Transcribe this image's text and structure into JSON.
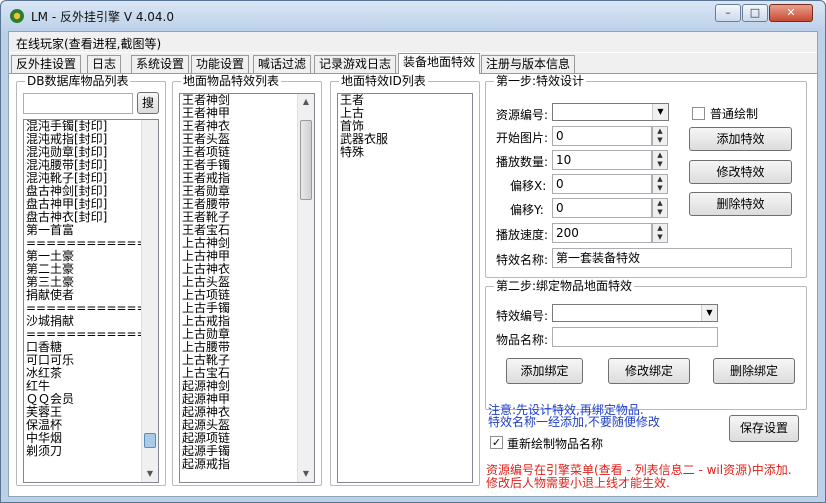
{
  "window": {
    "title": "LM - 反外挂引擎 V 4.04.0",
    "minimize": "–",
    "maximize": "□",
    "close": "✕"
  },
  "menu": {
    "online_players": "在线玩家(查看进程,截图等)"
  },
  "tabs": [
    "反外挂设置",
    "日志",
    "系统设置",
    "功能设置",
    "喊话过滤",
    "记录游戏日志",
    "装备地面特效",
    "注册与版本信息"
  ],
  "db_panel": {
    "legend": "DB数据库物品列表",
    "search_value": "",
    "search_button": "搜",
    "items": [
      "混沌手镯[封印]",
      "混沌戒指[封印]",
      "混沌勋章[封印]",
      "混沌腰带[封印]",
      "混沌靴子[封印]",
      "盘古神剑[封印]",
      "盘古神甲[封印]",
      "盘古神衣[封印]",
      "第一首富",
      "=================",
      "第一土豪",
      "第二土豪",
      "第三土豪",
      "捐献使者",
      "=================",
      "沙城捐献",
      "=================",
      "口香糖",
      "可口可乐",
      "冰红茶",
      "红牛",
      "ＱＱ会员",
      "芙蓉王",
      "保温杯",
      "中华烟",
      "剃须刀"
    ]
  },
  "ground_effect_panel": {
    "legend": "地面物品特效列表",
    "items": [
      "王者神剑",
      "王者神甲",
      "王者神衣",
      "王者头盔",
      "王者项链",
      "王者手镯",
      "王者戒指",
      "王者勋章",
      "王者腰带",
      "王者靴子",
      "王者宝石",
      "上古神剑",
      "上古神甲",
      "上古神衣",
      "上古头盔",
      "上古项链",
      "上古手镯",
      "上古戒指",
      "上古勋章",
      "上古腰带",
      "上古靴子",
      "上古宝石",
      "起源神剑",
      "起源神甲",
      "起源神衣",
      "起源头盔",
      "起源项链",
      "起源手镯",
      "起源戒指"
    ]
  },
  "effect_id_panel": {
    "legend": "地面特效ID列表",
    "items": [
      "王者",
      "上古",
      "首饰",
      "武器衣服",
      "特殊"
    ]
  },
  "step1": {
    "legend": "第一步:特效设计",
    "resource_label": "资源编号:",
    "resource_value": "",
    "normal_draw_label": "普通绘制",
    "normal_draw_checked": false,
    "start_image_label": "开始图片:",
    "start_image_value": "0",
    "play_count_label": "播放数量:",
    "play_count_value": "10",
    "offset_x_label": "偏移X:",
    "offset_x_value": "0",
    "offset_y_label": "偏移Y:",
    "offset_y_value": "0",
    "play_speed_label": "播放速度:",
    "play_speed_value": "200",
    "effect_name_label": "特效名称:",
    "effect_name_value": "第一套装备特效",
    "add_button": "添加特效",
    "edit_button": "修改特效",
    "delete_button": "删除特效"
  },
  "step2": {
    "legend": "第二步:绑定物品地面特效",
    "effect_id_label": "特效编号:",
    "effect_id_value": "",
    "item_name_label": "物品名称:",
    "item_name_value": "",
    "add_button": "添加绑定",
    "edit_button": "修改绑定",
    "delete_button": "删除绑定"
  },
  "notes": {
    "blue_line1": "注意:先设计特效,再绑定物品.",
    "blue_line2": "特效名称一经添加,不要随便修改",
    "redraw_label": "重新绘制物品名称",
    "redraw_checked": true,
    "save_button": "保存设置",
    "red_line1": "资源编号在引擎菜单(查看 - 列表信息二 - wil资源)中添加.",
    "red_line2": "修改后人物需要小退上线才能生效."
  },
  "colors": {
    "accent_blue": "#1d3ec7",
    "warning_red": "#e0211b",
    "frame": "#bcd0e6"
  }
}
